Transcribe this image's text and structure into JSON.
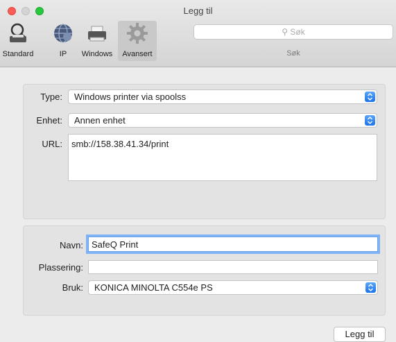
{
  "window": {
    "title": "Legg til"
  },
  "toolbar": {
    "items": [
      {
        "label": "Standard",
        "icon": "standard-printer-icon"
      },
      {
        "label": "IP",
        "icon": "globe-icon"
      },
      {
        "label": "Windows",
        "icon": "windows-printer-icon"
      },
      {
        "label": "Avansert",
        "icon": "gear-icon",
        "selected": true
      }
    ],
    "search": {
      "placeholder": "Søk",
      "label": "Søk"
    }
  },
  "form_top": {
    "type_label": "Type:",
    "type_value": "Windows printer via spoolss",
    "device_label": "Enhet:",
    "device_value": "Annen enhet",
    "url_label": "URL:",
    "url_value": "smb://158.38.41.34/print"
  },
  "form_bottom": {
    "name_label": "Navn:",
    "name_value": "SafeQ Print",
    "location_label": "Plassering:",
    "location_value": "",
    "use_label": "Bruk:",
    "use_value": "KONICA MINOLTA C554e PS"
  },
  "footer": {
    "add_button": "Legg til"
  },
  "colors": {
    "accent": "#1a73ea",
    "focus_ring": "#7eb3f5",
    "close": "#fc5c56",
    "zoom": "#27c840"
  }
}
